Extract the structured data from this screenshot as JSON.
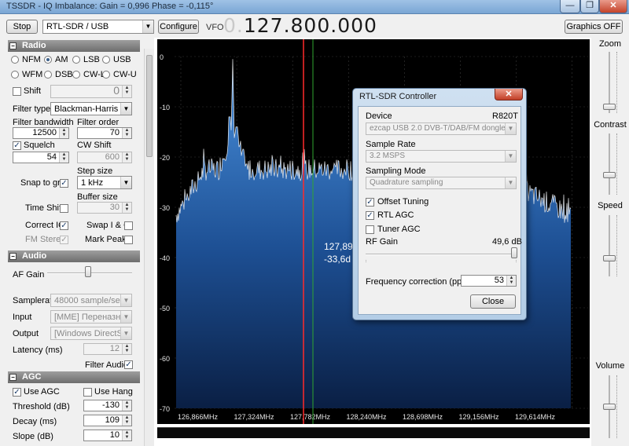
{
  "window": {
    "title": "TSSDR - IQ Imbalance: Gain = 0,996 Phase = -0,115°",
    "controls": {
      "minimize": "—",
      "maximize": "❐",
      "close": "✕"
    }
  },
  "toolbar": {
    "stop_label": "Stop",
    "source_value": "RTL-SDR / USB",
    "configure_label": "Configure",
    "vfo_label": "VFO",
    "vfo_lead": "0.",
    "vfo_value": "127.800.000",
    "graphics_label": "Graphics OFF"
  },
  "radio": {
    "header": "Radio",
    "modes": [
      "NFM",
      "AM",
      "LSB",
      "USB",
      "WFM",
      "DSB",
      "CW-L",
      "CW-U"
    ],
    "selected_mode": "AM",
    "shift_label": "Shift",
    "shift_value": "0",
    "filter_type_label": "Filter type",
    "filter_type_value": "Blackman-Harris",
    "filter_bandwidth_label": "Filter bandwidth",
    "filter_bandwidth_value": "12500",
    "filter_order_label": "Filter order",
    "filter_order_value": "70",
    "squelch_label": "Squelch",
    "squelch_value": "54",
    "cw_shift_label": "CW Shift",
    "cw_shift_value": "600",
    "snap_label": "Snap to grid",
    "step_size_label": "Step size",
    "step_size_value": "1 kHz",
    "buffer_size_label": "Buffer size",
    "time_shift_label": "Time Shift",
    "buffer_size_value": "30",
    "correct_iq_label": "Correct IQ",
    "swap_iq_label": "Swap I & Q",
    "fm_stereo_label": "FM Stereo",
    "mark_peaks_label": "Mark Peaks"
  },
  "audio": {
    "header": "Audio",
    "af_gain_label": "AF Gain",
    "af_gain_level": 0.48,
    "samplerate_label": "Samplerate",
    "samplerate_value": "48000 sample/sec",
    "input_label": "Input",
    "input_value": "[MME] Переназначени",
    "output_label": "Output",
    "output_value": "[Windows DirectSound]",
    "latency_label": "Latency (ms)",
    "latency_value": "12",
    "filter_audio_label": "Filter Audio"
  },
  "agc": {
    "header": "AGC",
    "use_agc_label": "Use AGC",
    "use_hang_label": "Use Hang",
    "threshold_label": "Threshold (dB)",
    "threshold_value": "-130",
    "decay_label": "Decay (ms)",
    "decay_value": "109",
    "slope_label": "Slope (dB)",
    "slope_value": "10"
  },
  "spectrum": {
    "db_ticks": [
      "0",
      "-10",
      "-20",
      "-30",
      "-40",
      "-50",
      "-60",
      "-70"
    ],
    "freq_ticks": [
      "126,866MHz",
      "127,324MHz",
      "127,782MHz",
      "128,240MHz",
      "128,698MHz",
      "129,156MHz",
      "129,614MHz"
    ],
    "cursor_freq": "127,89",
    "cursor_level": "-33,6d",
    "colors": {
      "background": "#000000",
      "fill_top": "#3d86d6",
      "fill_bottom": "#0d2650",
      "trace": "#ffffff",
      "tuned_line": "#ff2020",
      "cursor_line": "#30b030"
    }
  },
  "right_panel": {
    "zoom_label": "Zoom",
    "contrast_label": "Contrast",
    "speed_label": "Speed",
    "volume_label": "Volume"
  },
  "dialog": {
    "title": "RTL-SDR Controller",
    "close_glyph": "✕",
    "device_label": "Device",
    "device_tuner": "R820T",
    "device_value": "ezcap USB 2.0 DVB-T/DAB/FM dongle",
    "sample_rate_label": "Sample Rate",
    "sample_rate_value": "3.2 MSPS",
    "sampling_mode_label": "Sampling Mode",
    "sampling_mode_value": "Quadrature sampling",
    "offset_tuning_label": "Offset Tuning",
    "rtl_agc_label": "RTL AGC",
    "tuner_agc_label": "Tuner AGC",
    "rf_gain_label": "RF Gain",
    "rf_gain_value": "49,6 dB",
    "freq_corr_label": "Frequency correction (ppm)",
    "freq_corr_value": "53",
    "close_label": "Close"
  }
}
